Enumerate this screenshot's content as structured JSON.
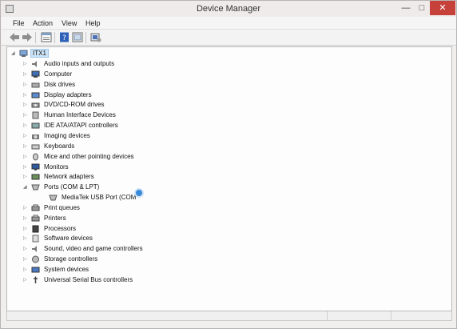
{
  "window": {
    "title": "Device Manager"
  },
  "menu": [
    "File",
    "Action",
    "View",
    "Help"
  ],
  "toolbar": [
    "back-arrow-icon",
    "forward-arrow-icon",
    "properties-icon",
    "help-icon",
    "show-hidden-icon",
    "scan-hardware-icon"
  ],
  "tree": {
    "root": "ITX1",
    "items": [
      {
        "label": "Audio inputs and outputs",
        "icon": "speaker-icon",
        "expanded": false
      },
      {
        "label": "Computer",
        "icon": "computer-icon",
        "expanded": false
      },
      {
        "label": "Disk drives",
        "icon": "disk-drive-icon",
        "expanded": false
      },
      {
        "label": "Display adapters",
        "icon": "display-adapter-icon",
        "expanded": false
      },
      {
        "label": "DVD/CD-ROM drives",
        "icon": "dvd-icon",
        "expanded": false
      },
      {
        "label": "Human Interface Devices",
        "icon": "hid-icon",
        "expanded": false
      },
      {
        "label": "IDE ATA/ATAPI controllers",
        "icon": "ide-controller-icon",
        "expanded": false
      },
      {
        "label": "Imaging devices",
        "icon": "camera-icon",
        "expanded": false
      },
      {
        "label": "Keyboards",
        "icon": "keyboard-icon",
        "expanded": false
      },
      {
        "label": "Mice and other pointing devices",
        "icon": "mouse-icon",
        "expanded": false
      },
      {
        "label": "Monitors",
        "icon": "monitor-icon",
        "expanded": false
      },
      {
        "label": "Network adapters",
        "icon": "network-icon",
        "expanded": false
      },
      {
        "label": "Ports (COM & LPT)",
        "icon": "port-icon",
        "expanded": true
      },
      {
        "label": "MediaTek USB Port (COM",
        "icon": "port-icon",
        "child": true
      },
      {
        "label": "Print queues",
        "icon": "printer-icon",
        "expanded": false
      },
      {
        "label": "Printers",
        "icon": "printer-icon",
        "expanded": false
      },
      {
        "label": "Processors",
        "icon": "processor-icon",
        "expanded": false
      },
      {
        "label": "Software devices",
        "icon": "software-device-icon",
        "expanded": false
      },
      {
        "label": "Sound, video and game controllers",
        "icon": "speaker-icon",
        "expanded": false
      },
      {
        "label": "Storage controllers",
        "icon": "storage-icon",
        "expanded": false
      },
      {
        "label": "System devices",
        "icon": "system-icon",
        "expanded": false
      },
      {
        "label": "Universal Serial Bus controllers",
        "icon": "usb-icon",
        "expanded": false
      }
    ]
  },
  "colors": {
    "selection": "#cce4f7",
    "close_button": "#c7413b",
    "cursor": "#3b8ad9"
  }
}
